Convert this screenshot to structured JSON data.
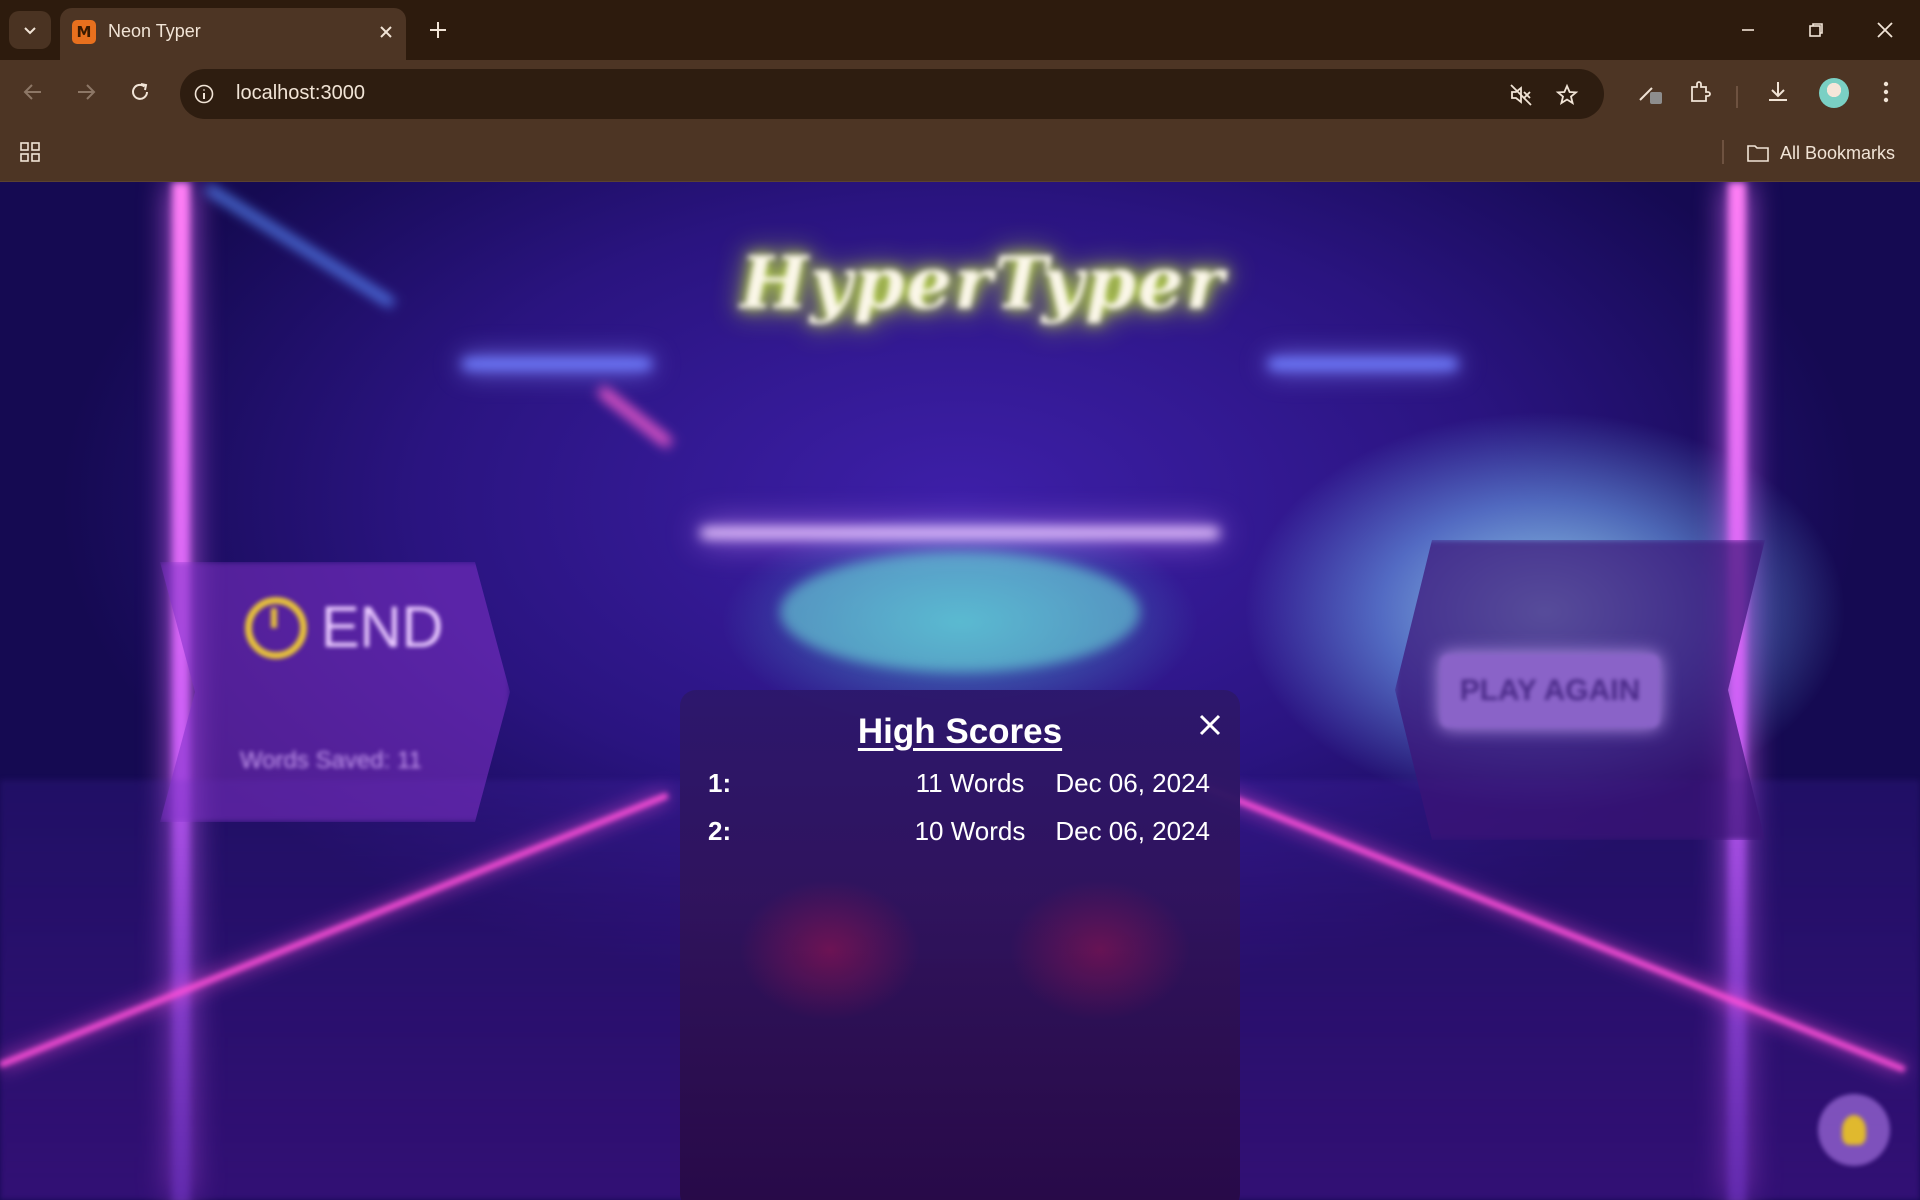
{
  "browser": {
    "tab_title": "Neon Typer",
    "favicon_letter": "M",
    "url": "localhost:3000",
    "all_bookmarks_label": "All Bookmarks"
  },
  "game": {
    "sign_title": "HyperTyper",
    "end_label": "END",
    "words_saved_text": "Words Saved: 11",
    "play_again_label": "PLAY AGAIN"
  },
  "high_scores": {
    "title": "High Scores",
    "close_label": "X",
    "entries": [
      {
        "rank": "1:",
        "words": "11 Words",
        "date": "Dec 06, 2024"
      },
      {
        "rank": "2:",
        "words": "10 Words",
        "date": "Dec 06, 2024"
      }
    ]
  },
  "colors": {
    "chrome_bg": "#2d1b0d",
    "toolbar_bg": "#4d3524",
    "modal_bg": "#2d186c",
    "neon_pink": "#ff4fd8",
    "neon_yellow": "#d7ff3a"
  }
}
